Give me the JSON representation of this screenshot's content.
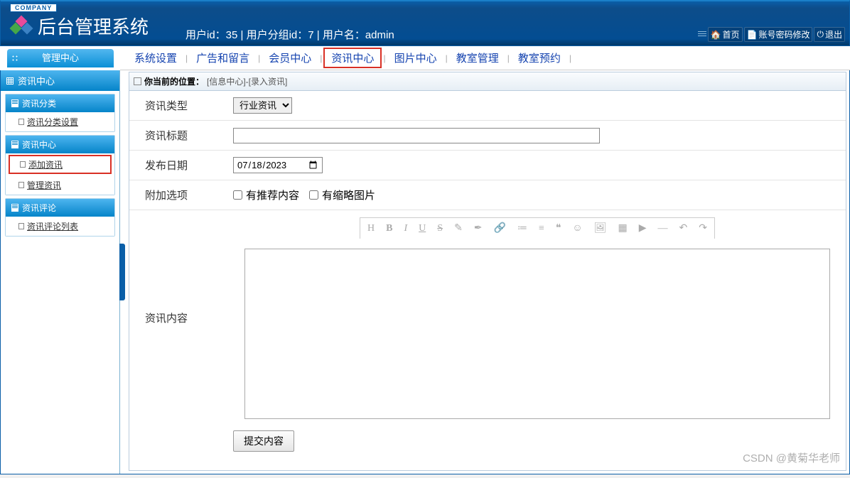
{
  "header": {
    "company_badge": "COMPANY",
    "system_title": "后台管理系统",
    "user_info": "用户id：35 | 用户分组id：7 | 用户名：admin",
    "actions": {
      "home": "首页",
      "account": "账号密码修改",
      "logout": "退出"
    }
  },
  "mgmt_tab": "管理中心",
  "nav": {
    "items": [
      "系统设置",
      "广告和留言",
      "会员中心",
      "资讯中心",
      "图片中心",
      "教室管理",
      "教室预约"
    ],
    "highlighted": "资讯中心"
  },
  "sidebar": {
    "title": "资讯中心",
    "groups": [
      {
        "title": "资讯分类",
        "items": [
          {
            "label": "资讯分类设置",
            "highlight": false
          }
        ]
      },
      {
        "title": "资讯中心",
        "items": [
          {
            "label": "添加资讯",
            "highlight": true
          },
          {
            "label": "管理资讯",
            "highlight": false
          }
        ]
      },
      {
        "title": "资讯评论",
        "items": [
          {
            "label": "资讯评论列表",
            "highlight": false
          }
        ]
      }
    ]
  },
  "breadcrumb": {
    "label": "你当前的位置：",
    "path": "[信息中心]-[录入资讯]"
  },
  "form": {
    "type": {
      "label": "资讯类型",
      "options": [
        "行业资讯"
      ],
      "value": "行业资讯"
    },
    "title": {
      "label": "资讯标题",
      "value": ""
    },
    "date": {
      "label": "发布日期",
      "value": "2023-07-18",
      "display": "2023/07/18"
    },
    "extra": {
      "label": "附加选项",
      "recommend": "有推荐内容",
      "thumbnail": "有缩略图片",
      "recommend_checked": false,
      "thumbnail_checked": false
    },
    "content": {
      "label": "资讯内容",
      "value": ""
    },
    "submit": "提交内容"
  },
  "editor_toolbar": [
    "H",
    "B",
    "I",
    "U",
    "S",
    "✎",
    "✒",
    "🔗",
    "≔",
    "≡",
    "❝",
    "☺",
    "🖼",
    "▦",
    "▶",
    "—",
    "↶",
    "↷"
  ],
  "watermark": "CSDN @黄菊华老师"
}
